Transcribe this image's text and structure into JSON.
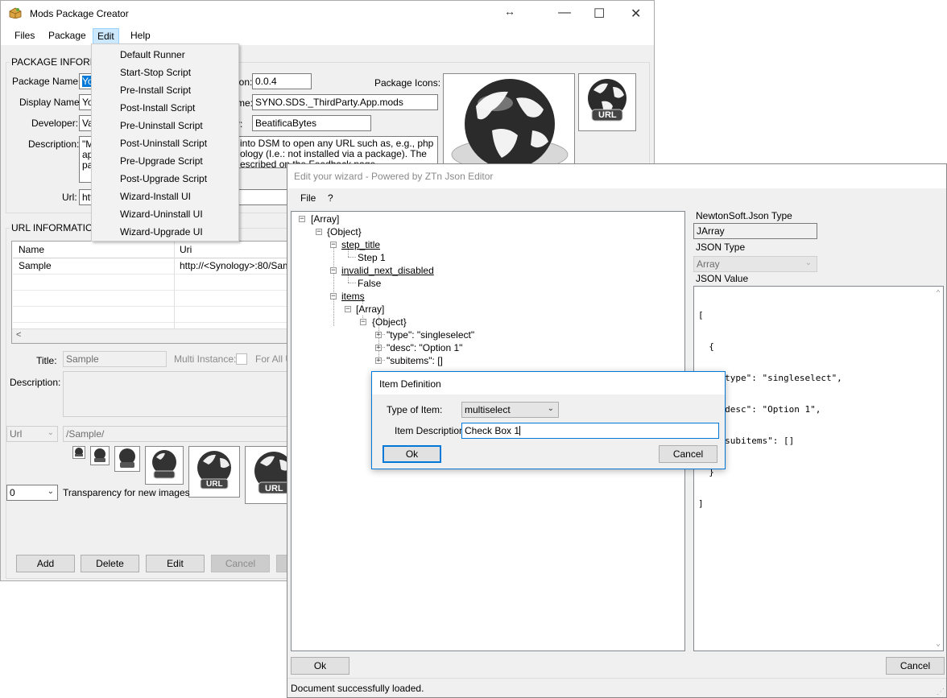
{
  "main_window": {
    "title": "Mods Package Creator",
    "menu": [
      "Files",
      "Package",
      "Edit",
      "Help"
    ],
    "package_group_title": "PACKAGE INFORMA",
    "labels": {
      "package_name": "Package Name:",
      "display_name": "Display Name:",
      "developer": "Developer:",
      "description": "Description:",
      "url": "Url:",
      "version_suffix": "ion:",
      "name_suffix": "me:",
      "author_suffix": "r:",
      "package_icons": "Package Icons:"
    },
    "values": {
      "package_name": "Yo",
      "display_name": "Yo",
      "developer": "Va",
      "description_l1": "\"Mo",
      "description_l2": "ap",
      "description_l3": "pa",
      "description_r1": "into DSM to open any URL such as, e.g., php",
      "description_r2": "ology (I.e.: not installed via a package). The",
      "description_r3": "escribed on the Feedback page",
      "url": "htt",
      "version": "0.0.4",
      "package_id": "SYNO.SDS._ThirdParty.App.mods",
      "author": "BeatificaBytes"
    },
    "url_group_title": "URL INFORMATION",
    "grid": {
      "headers": [
        "Name",
        "Uri"
      ],
      "rows": [
        [
          "Sample",
          "http://<Synology>:80/Sampl"
        ]
      ]
    },
    "form": {
      "title_label": "Title:",
      "title_value": "Sample",
      "multi_instance_label": "Multi Instance:",
      "for_all_label": "For All U",
      "description_label": "Description:",
      "type_value": "Url",
      "path_value": "/Sample/",
      "transparency_value": "0",
      "transparency_label": "Transparency for new images"
    },
    "buttons": [
      "Add",
      "Delete",
      "Edit",
      "Cancel"
    ],
    "url_badge": "URL"
  },
  "edit_menu": {
    "items": [
      "Default Runner",
      "Start-Stop Script",
      "Pre-Install Script",
      "Post-Install Script",
      "Pre-Uninstall Script",
      "Post-Uninstall Script",
      "Pre-Upgrade Script",
      "Post-Upgrade Script",
      "Wizard-Install UI",
      "Wizard-Uninstall UI",
      "Wizard-Upgrade UI"
    ]
  },
  "json_editor": {
    "title": "Edit your wizard - Powered by ZTn Json Editor",
    "menu": [
      "File",
      "?"
    ],
    "tree": {
      "root": "[Array]",
      "object": "{Object}",
      "step_title": "step_title",
      "step_value": "Step 1",
      "invalid_next": "invalid_next_disabled",
      "invalid_value": "False",
      "items": "items",
      "items_array": "[Array]",
      "items_object": "{Object}",
      "type_entry": "\"type\": \"singleselect\"",
      "desc_entry": "\"desc\": \"Option 1\"",
      "subitems_entry": "\"subitems\": []"
    },
    "right": {
      "newtonsoft_label": "NewtonSoft.Json Type",
      "newtonsoft_value": "JArray",
      "json_type_label": "JSON Type",
      "json_type_value": "Array",
      "json_value_label": "JSON Value",
      "json_lines": [
        "[",
        "  {",
        "    \"type\": \"singleselect\",",
        "    \"desc\": \"Option 1\",",
        "    \"subitems\": []",
        "  }",
        "]"
      ]
    },
    "ok_label": "Ok",
    "cancel_label": "Cancel",
    "status": "Document successfully loaded."
  },
  "item_dialog": {
    "title": "Item Definition",
    "type_label": "Type of Item:",
    "type_value": "multiselect",
    "desc_label": "Item Description:",
    "desc_value": "Check Box 1",
    "ok_label": "Ok",
    "cancel_label": "Cancel"
  },
  "colors": {
    "selection": "#0078d7",
    "focus": "#0078d7"
  }
}
